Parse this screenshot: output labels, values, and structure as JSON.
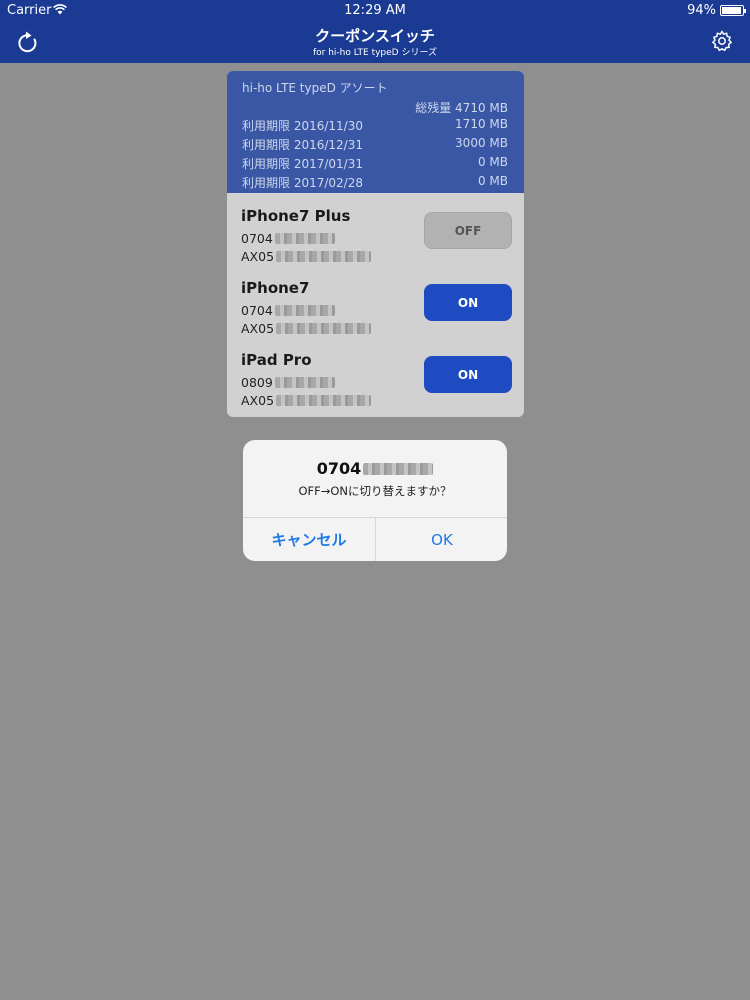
{
  "status_bar": {
    "carrier": "Carrier",
    "time": "12:29 AM",
    "battery_percent": "94%",
    "battery_level": 0.94
  },
  "nav": {
    "title": "クーポンスイッチ",
    "subtitle": "for hi-ho LTE typeD シリーズ",
    "left_icon": "refresh-icon",
    "right_icon": "gear-icon"
  },
  "plan": {
    "name": "hi-ho LTE typeD アソート",
    "total_label": "総残量 4710 MB",
    "periods": [
      {
        "label": "利用期限 2016/11/30",
        "amount": "1710 MB"
      },
      {
        "label": "利用期限 2016/12/31",
        "amount": "3000 MB"
      },
      {
        "label": "利用期限 2017/01/31",
        "amount": "0  MB"
      },
      {
        "label": "利用期限 2017/02/28",
        "amount": "0  MB"
      }
    ]
  },
  "devices": [
    {
      "name": "iPhone7 Plus",
      "number_prefix": "0704",
      "sim_prefix": "AX05",
      "state": "OFF"
    },
    {
      "name": "iPhone7",
      "number_prefix": "0704",
      "sim_prefix": "AX05",
      "state": "ON"
    },
    {
      "name": "iPad Pro",
      "number_prefix": "0809",
      "sim_prefix": "AX05",
      "state": "ON"
    }
  ],
  "alert": {
    "title_prefix": "0704",
    "message": "OFF→ONに切り替えますか？",
    "cancel_label": "キャンセル",
    "ok_label": "OK"
  },
  "colors": {
    "navbar": "#1a3a93",
    "plan_header": "#3957a4",
    "toggle_on": "#1e4bc2",
    "toggle_off": "#b2b2b2",
    "alert_button": "#1f7ae8"
  }
}
